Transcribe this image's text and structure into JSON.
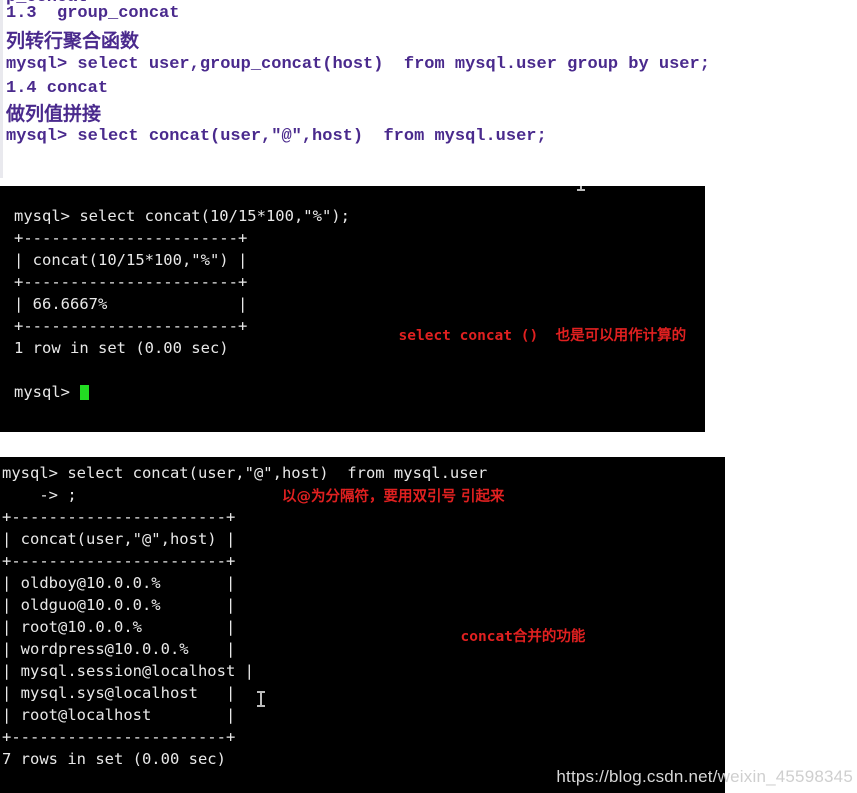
{
  "notes": {
    "clipped_top_line": "p_concat",
    "lines": [
      {
        "text": "1.3  group_concat",
        "kind": "mono"
      },
      {
        "text": "列转行聚合函数",
        "kind": "cjk"
      },
      {
        "text": "mysql> select user,group_concat(host)  from mysql.user group by user;",
        "kind": "mono"
      },
      {
        "text": "1.4 concat",
        "kind": "mono"
      },
      {
        "text": "做列值拼接",
        "kind": "cjk"
      },
      {
        "text": "mysql> select concat(user,\"@\",host)  from mysql.user;",
        "kind": "mono"
      }
    ],
    "text_color": "#4a2a8d"
  },
  "terminal_one": {
    "name": "mysql-terminal-concat-percent",
    "background": "#000000",
    "foreground": "#e8e8e8",
    "cursor_color": "#22dd22",
    "lines": [
      "mysql> select concat(10/15*100,\"%\");",
      "+-----------------------+",
      "| concat(10/15*100,\"%\") |",
      "+-----------------------+",
      "| 66.6667%              |",
      "+-----------------------+",
      "1 row in set (0.00 sec)",
      "",
      "mysql> "
    ],
    "annotation": {
      "mono_part": "select concat ()  ",
      "cjk_part": "也是可以用作计算的",
      "color": "#e02020"
    }
  },
  "terminal_two": {
    "name": "mysql-terminal-concat-user-host",
    "background": "#000000",
    "foreground": "#e8e8e8",
    "lines": [
      "mysql> select concat(user,\"@\",host)  from mysql.user",
      "    -> ;",
      "+-----------------------+",
      "| concat(user,\"@\",host) |",
      "+-----------------------+",
      "| oldboy@10.0.0.%       |",
      "| oldguo@10.0.0.%       |",
      "| root@10.0.0.%         |",
      "| wordpress@10.0.0.%    |",
      "| mysql.session@localhost |",
      "| mysql.sys@localhost   |",
      "| root@localhost        |",
      "+-----------------------+",
      "7 rows in set (0.00 sec)"
    ],
    "annotation_separator": "以@为分隔符，要用双引号 引起来",
    "annotation_merge_mono": "concat",
    "annotation_merge_cjk": "合并的功能",
    "annotation_color": "#e02020"
  },
  "watermark": {
    "prefix": "https://blog.csdn.net/",
    "suffix": "weixin_45598345"
  }
}
